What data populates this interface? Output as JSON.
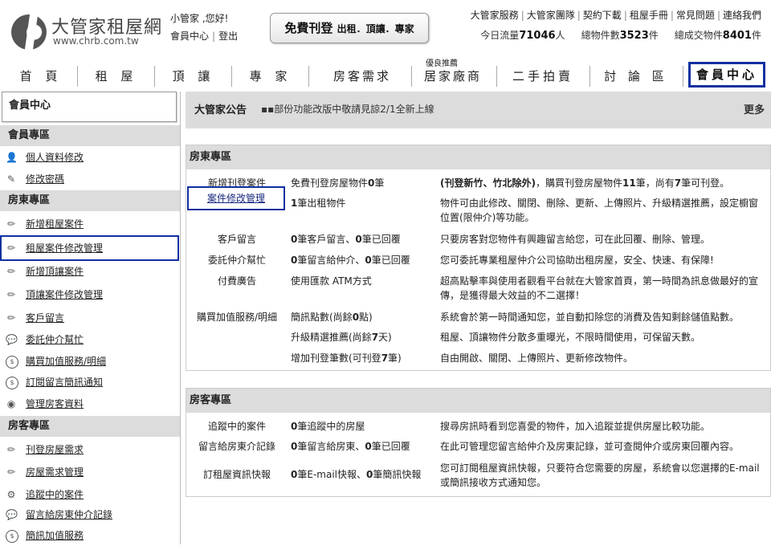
{
  "header": {
    "brand": "大管家租屋網",
    "url": "www.chrb.com.tw",
    "greeting": "小管家 ,您好!",
    "member_center": "會員中心",
    "logout": "登出",
    "promo_main": "免費刊登",
    "promo_sub": "出租．頂讓．專家",
    "top_links": [
      "大管家服務",
      "大管家團隊",
      "契約下載",
      "租屋手冊",
      "常見問題",
      "連絡我們"
    ],
    "stats": {
      "today_label": "今日流量",
      "today_value": "71046",
      "today_unit": "人",
      "objects_label": "總物件數",
      "objects_value": "3523",
      "objects_unit": "件",
      "deals_label": "總成交物件",
      "deals_value": "8401",
      "deals_unit": "件"
    }
  },
  "nav": {
    "items": [
      "首 頁",
      "租 屋",
      "頂 讓",
      "專 家",
      "房客需求",
      "居家廠商",
      "二手拍賣",
      "討 論 區"
    ],
    "tag": "優良推薦",
    "member": "會員中心"
  },
  "sidebar": {
    "title": "會員中心",
    "sections": [
      {
        "head": "會員專區",
        "items": [
          {
            "label": "個人資料修改",
            "icon": "user-edit-icon"
          },
          {
            "label": "修改密碼",
            "icon": "note-icon"
          }
        ]
      },
      {
        "head": "房東專區",
        "items": [
          {
            "label": "新增租屋案件",
            "icon": "pencil-icon"
          },
          {
            "label": "租屋案件修改管理",
            "icon": "pencil-icon"
          },
          {
            "label": "新增頂讓案件",
            "icon": "pencil-icon"
          },
          {
            "label": "頂讓案件修改管理",
            "icon": "pencil-icon"
          },
          {
            "label": "客戶留言",
            "icon": "pencil-icon"
          },
          {
            "label": "委託仲介幫忙",
            "icon": "chat-icon"
          },
          {
            "label": "購買加值服務/明細",
            "icon": "coin-icon"
          },
          {
            "label": "訂閱留言簡訊通知",
            "icon": "coin-icon"
          },
          {
            "label": "管理房客資料",
            "icon": "eye-icon"
          }
        ]
      },
      {
        "head": "房客專區",
        "items": [
          {
            "label": "刊登房屋需求",
            "icon": "pencil-icon"
          },
          {
            "label": "房屋需求管理",
            "icon": "pencil-icon"
          },
          {
            "label": "追蹤中的案件",
            "icon": "gear-icon"
          },
          {
            "label": "留言給房東仲介記錄",
            "icon": "chat-icon"
          },
          {
            "label": "簡訊加值服務",
            "icon": "coin-icon"
          }
        ]
      }
    ]
  },
  "announce": {
    "title": "大管家公告",
    "text": "▪▪部份功能改版中敬請見諒2/1全新上線",
    "more": "更多"
  },
  "landlord": {
    "head": "房東專區",
    "rows": [
      {
        "name": "新增刊登案件",
        "status_pre": "免費刊登房屋物件",
        "status_num": "0",
        "status_post": "筆",
        "desc_b1": "(刊登新竹、竹北除外)",
        "desc_t1": "，購買刊登房屋物件",
        "desc_b2": "11",
        "desc_t2": "筆，尚有",
        "desc_b3": "7",
        "desc_t3": "筆可刊登。"
      },
      {
        "name": "案件修改管理",
        "status_num": "1",
        "status_post": "筆出租物件",
        "desc": "物件可由此修改、關閉、刪除、更新、上傳照片、升級精選推薦，設定櫥窗位置(限仲介)等功能。"
      },
      {
        "name": "客戶留言",
        "status_a": "0",
        "status_b": "筆客戶留言、",
        "status_c": "0",
        "status_d": "筆已回覆",
        "desc": "只要房客對您物件有興趣留言給您，可在此回覆、刪除、管理。"
      },
      {
        "name": "委託仲介幫忙",
        "status_a": "0",
        "status_b": "筆留言給仲介、",
        "status_c": "0",
        "status_d": "筆已回覆",
        "desc": "您可委託專業租屋仲介公司協助出租房屋，安全、快速、有保障!"
      },
      {
        "name": "付費廣告",
        "status": "使用匯款 ATM方式",
        "desc": "超高點擊率與使用者觀看平台就在大管家首頁，第一時間為訊息做最好的宣傳，是獲得最大效益的不二選擇！"
      },
      {
        "name": "購買加值服務/明細",
        "status_pre": "簡訊點數(尚餘",
        "status_num": "0",
        "status_post": "點)",
        "desc": "系統會於第一時間通知您，並自動扣除您的消費及告知剩餘儲值點數。"
      },
      {
        "status_pre": "升級精選推薦(尚餘",
        "status_num": "7",
        "status_post": "天)",
        "desc": "租屋、頂讓物件分散多重曝光，不限時間使用，可保留天數。"
      },
      {
        "status_pre": "增加刊登筆數(可刊登",
        "status_num": "7",
        "status_post": "筆)",
        "desc": "自由開啟、關閉、上傳照片、更新修改物件。"
      }
    ]
  },
  "tenant": {
    "head": "房客專區",
    "rows": [
      {
        "name": "追蹤中的案件",
        "status_num": "0",
        "status_post": "筆追蹤中的房屋",
        "desc": "搜尋房訊時看到您喜愛的物件，加入追蹤並提供房屋比較功能。"
      },
      {
        "name": "留言給房東介記錄",
        "status_a": "0",
        "status_b": "筆留言給房東、",
        "status_c": "0",
        "status_d": "筆已回覆",
        "desc": "在此可管理您留言給仲介及房東記錄，並可查閱仲介或房東回覆內容。"
      },
      {
        "name": "訂租屋資訊快報",
        "status_a": "0",
        "status_b": "筆E-mail快報、",
        "status_c": "0",
        "status_d": "筆簡訊快報",
        "desc": "您可訂閱租屋資訊快報，只要符合您需要的房屋，系統會以您選擇的E-mail或簡訊接收方式通知您。"
      }
    ]
  }
}
